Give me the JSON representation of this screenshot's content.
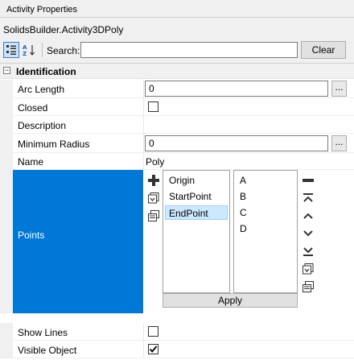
{
  "panel": {
    "title": "Activity Properties"
  },
  "subject": "SolidsBuilder.Activity3DPoly",
  "toolbar": {
    "categorized_icon": "categorized-view-icon",
    "alpha_icon": "alphabetical-sort-icon",
    "search_label": "Search:",
    "search_value": "",
    "clear_label": "Clear"
  },
  "category": {
    "toggle": "−",
    "label": "Identification"
  },
  "properties": {
    "arc_length": {
      "name": "Arc Length",
      "value": "0",
      "button": "..."
    },
    "closed": {
      "name": "Closed",
      "checked": false
    },
    "description": {
      "name": "Description",
      "value": ""
    },
    "minimum_radius": {
      "name": "Minimum Radius",
      "value": "0",
      "button": "..."
    },
    "name": {
      "name": "Name",
      "value": "Poly"
    },
    "points": {
      "name": "Points",
      "items": [
        "Origin",
        "StartPoint",
        "EndPoint"
      ],
      "selected": "EndPoint",
      "values": [
        "A",
        "B",
        "C",
        "D"
      ],
      "apply_label": "Apply"
    },
    "show_lines": {
      "name": "Show Lines",
      "checked": false
    },
    "visible_object": {
      "name": "Visible Object",
      "checked": true
    }
  },
  "colors": {
    "selection": "#0078d7",
    "list_selected": "#cce8ff"
  }
}
